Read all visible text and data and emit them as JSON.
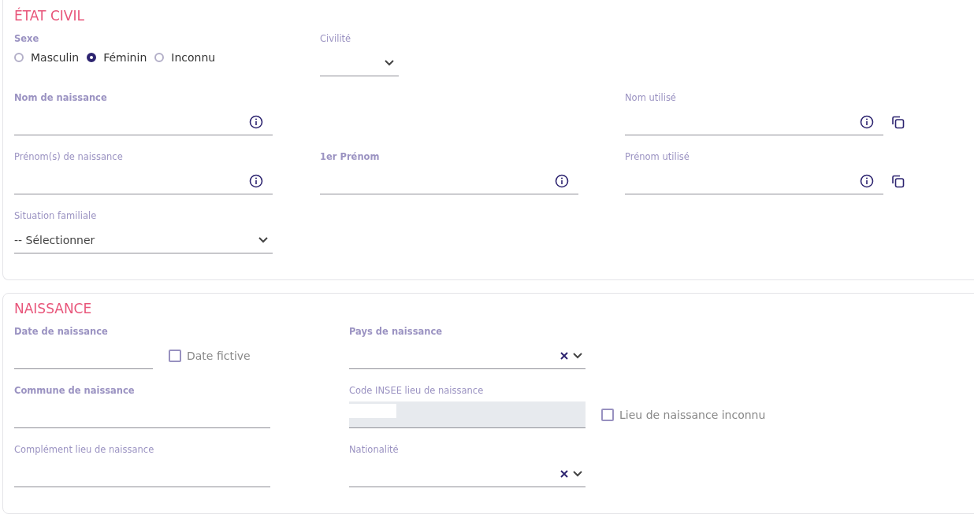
{
  "sections": [
    {
      "title": "ÉTAT CIVIL",
      "rows": [
        {
          "left": {
            "kind": "radio",
            "label": "Sexe",
            "required": true,
            "options": [
              {
                "label": "Masculin",
                "selected": false
              },
              {
                "label": "Féminin",
                "selected": true
              },
              {
                "label": "Inconnu",
                "selected": false
              }
            ]
          },
          "middle": {
            "kind": "select",
            "label": "Civilité",
            "required": false,
            "narrow": true
          }
        },
        {
          "left": {
            "kind": "text",
            "label": "Nom de naissance",
            "required": true,
            "info_button": true
          },
          "right": {
            "kind": "text",
            "label": "Nom utilisé",
            "required": false,
            "info_button": true,
            "copy_button": true
          }
        },
        {
          "left": {
            "kind": "text",
            "label": "Prénom(s) de naissance",
            "required": false,
            "info_button": true
          },
          "middle": {
            "kind": "text",
            "label": "1er Prénom",
            "required": true,
            "info_button": true
          },
          "right": {
            "kind": "text",
            "label": "Prénom utilisé",
            "required": false,
            "info_button": true,
            "copy_button": true
          }
        },
        {
          "left": {
            "kind": "select",
            "label": "Situation familiale",
            "required": false,
            "narrow": false,
            "value": "-- Sélectionner"
          }
        }
      ]
    },
    {
      "title": "NAISSANCE",
      "rows": [
        {
          "left": {
            "kind": "date",
            "label": "Date de naissance",
            "required": true,
            "aside": {
              "label": "Date fictive",
              "checked": false
            }
          },
          "middle": {
            "kind": "autocomplete",
            "label": "Pays de naissance",
            "required": true
          }
        },
        {
          "left": {
            "kind": "text",
            "label": "Commune de naissance",
            "required": true
          },
          "middle": {
            "kind": "readonly",
            "label": "Code INSEE lieu de naissance",
            "required": false,
            "aside": {
              "label": "Lieu de naissance inconnu",
              "checked": false
            }
          }
        },
        {
          "left": {
            "kind": "text",
            "label": "Complément lieu de naissance",
            "required": false
          },
          "middle": {
            "kind": "autocomplete",
            "label": "Nationalité",
            "required": false
          }
        }
      ]
    }
  ]
}
